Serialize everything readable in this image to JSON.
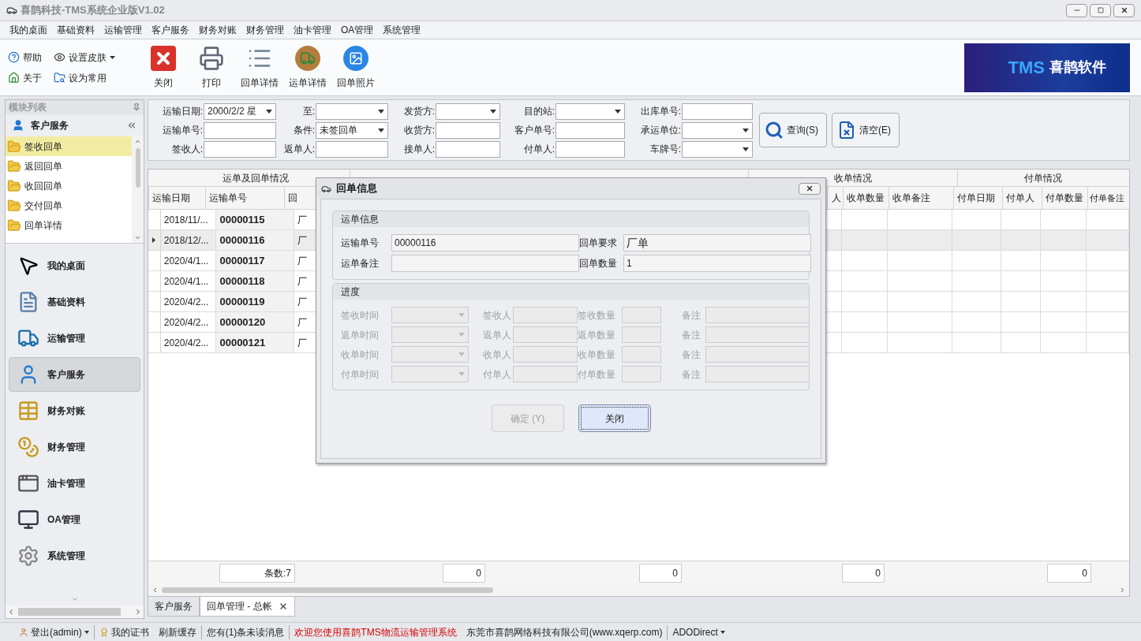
{
  "window": {
    "title": "喜鹊科技-TMS系统企业版V1.02"
  },
  "menu": [
    "我的桌面",
    "基础资料",
    "运输管理",
    "客户服务",
    "财务对账",
    "财务管理",
    "油卡管理",
    "OA管理",
    "系统管理"
  ],
  "ribbon": {
    "small": [
      {
        "label": "帮助",
        "dropdown": false
      },
      {
        "label": "设置皮肤",
        "dropdown": true
      },
      {
        "label": "关于",
        "dropdown": false
      },
      {
        "label": "设为常用",
        "dropdown": false
      }
    ],
    "large": [
      "关闭",
      "打印",
      "回单详情",
      "运单详情",
      "回单照片"
    ],
    "logo": {
      "mark": "TMS",
      "name": "喜鹊软件"
    }
  },
  "sidebar": {
    "title": "模块列表",
    "section": "客户服务",
    "items": [
      {
        "label": "签收回单",
        "selected": true
      },
      {
        "label": "返回回单",
        "selected": false
      },
      {
        "label": "收回回单",
        "selected": false
      },
      {
        "label": "交付回单",
        "selected": false
      },
      {
        "label": "回单详情",
        "selected": false
      }
    ],
    "modules": [
      {
        "label": "我的桌面",
        "selected": false
      },
      {
        "label": "基础资料",
        "selected": false
      },
      {
        "label": "运输管理",
        "selected": false
      },
      {
        "label": "客户服务",
        "selected": true
      },
      {
        "label": "财务对账",
        "selected": false
      },
      {
        "label": "财务管理",
        "selected": false
      },
      {
        "label": "油卡管理",
        "selected": false
      },
      {
        "label": "OA管理",
        "selected": false
      },
      {
        "label": "系统管理",
        "selected": false
      }
    ]
  },
  "filter": {
    "fields": [
      {
        "label": "运输日期:",
        "kind": "combo",
        "value": "2000/2/2 星"
      },
      {
        "label": "至:",
        "kind": "combo"
      },
      {
        "label": "发货方:",
        "kind": "combo"
      },
      {
        "label": "目的站:",
        "kind": "combo"
      },
      {
        "label": "出库单号:",
        "kind": "text"
      },
      {
        "label": "运输单号:",
        "kind": "text"
      },
      {
        "label": "条件:",
        "kind": "combo",
        "value": "未签回单"
      },
      {
        "label": "收货方:",
        "kind": "text"
      },
      {
        "label": "客户单号:",
        "kind": "text"
      },
      {
        "label": "承运单位:",
        "kind": "combo"
      },
      {
        "label": "签收人:",
        "kind": "text"
      },
      {
        "label": "返单人:",
        "kind": "text"
      },
      {
        "label": "接单人:",
        "kind": "text"
      },
      {
        "label": "付单人:",
        "kind": "text"
      },
      {
        "label": "车牌号:",
        "kind": "combo"
      }
    ],
    "buttons": [
      "查询(S)",
      "清空(E)"
    ]
  },
  "grid": {
    "groups": [
      "运单及回单情况",
      "收单情况",
      "付单情况"
    ],
    "columns": [
      "运输日期",
      "运输单号",
      "回",
      "人",
      "收单数量",
      "收单备注",
      "付单日期",
      "付单人",
      "付单数量",
      "付单备注"
    ],
    "rows": [
      {
        "date": "2018/11/...",
        "number": "00000115",
        "column_3": "厂",
        "selected": false
      },
      {
        "date": "2018/12/...",
        "number": "00000116",
        "column_3": "厂",
        "selected": true
      },
      {
        "date": "2020/4/1...",
        "number": "00000117",
        "column_3": "厂",
        "selected": false
      },
      {
        "date": "2020/4/1...",
        "number": "00000118",
        "column_3": "厂",
        "selected": false
      },
      {
        "date": "2020/4/2...",
        "number": "00000119",
        "column_3": "厂",
        "selected": false
      },
      {
        "date": "2020/4/2...",
        "number": "00000120",
        "column_3": "厂",
        "selected": false
      },
      {
        "date": "2020/4/2...",
        "number": "00000121",
        "column_3": "厂",
        "selected": false
      }
    ],
    "totals": [
      "条数:7",
      "0",
      "0",
      "0",
      "0"
    ]
  },
  "tabs": [
    {
      "label": "客户服务",
      "selected": false
    },
    {
      "label": "回单管理 - 总帐",
      "selected": true,
      "closable": true
    }
  ],
  "status_bar": [
    {
      "label": "登出(admin)",
      "kind": "user"
    },
    {
      "label": "我的证书",
      "kind": "cert"
    },
    {
      "label": "刷新缓存",
      "kind": "text"
    },
    {
      "label": "您有(1)条未读消息",
      "kind": "text"
    },
    {
      "label": "欢迎您使用喜鹊TMS物流运输管理系统",
      "kind": "alert"
    },
    {
      "label": "东莞市喜鹊网络科技有限公司(www.xqerp.com)",
      "kind": "text"
    },
    {
      "label": "ADODirect",
      "kind": "menu"
    }
  ],
  "dialog": {
    "title": "回单信息",
    "info": {
      "title": "运单信息",
      "fields": [
        {
          "label": "运输单号",
          "value": "00000116"
        },
        {
          "label": "回单要求",
          "value": "厂单"
        },
        {
          "label": "运单备注"
        },
        {
          "label": "回单数量",
          "value": "1"
        }
      ]
    },
    "progress": {
      "title": "进度",
      "disabled": true,
      "rows": [
        [
          "签收时间",
          "签收人",
          "签收数量",
          "备注"
        ],
        [
          "返单时间",
          "返单人",
          "返单数量",
          "备注"
        ],
        [
          "收单时间",
          "收单人",
          "收单数量",
          "备注"
        ],
        [
          "付单时间",
          "付单人",
          "付单数量",
          "备注"
        ]
      ]
    },
    "buttons": [
      {
        "label": "确定 (Y)",
        "disabled": true,
        "focused": false
      },
      {
        "label": "关闭",
        "disabled": false,
        "focused": true
      }
    ]
  }
}
